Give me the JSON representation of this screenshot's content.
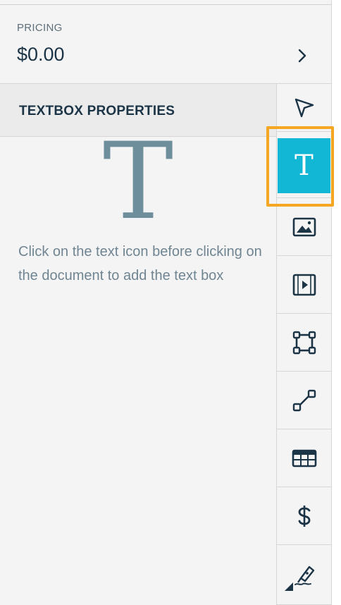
{
  "pricing": {
    "label": "PRICING",
    "value": "$0.00",
    "chevron_icon": "chevron-right-icon"
  },
  "section": {
    "title": "TEXTBOX PROPERTIES",
    "hero_glyph": "T",
    "help_text": "Click on the text icon before clicking on the document to add the text box"
  },
  "toolbar": {
    "active_tool": "text",
    "active_glyph": "T",
    "tools": [
      {
        "id": "select",
        "icon": "cursor-arrow-icon"
      },
      {
        "id": "text",
        "icon": "text-icon"
      },
      {
        "id": "image",
        "icon": "image-icon"
      },
      {
        "id": "video",
        "icon": "video-icon"
      },
      {
        "id": "shape",
        "icon": "shape-square-icon"
      },
      {
        "id": "line",
        "icon": "line-icon"
      },
      {
        "id": "table",
        "icon": "table-icon"
      },
      {
        "id": "pricing",
        "icon": "dollar-icon"
      },
      {
        "id": "signature",
        "icon": "signature-pen-icon"
      }
    ]
  },
  "colors": {
    "accent": "#13b7d6",
    "highlight": "#f5a623",
    "dark_text": "#1b3446",
    "muted_text": "#6f8592"
  }
}
